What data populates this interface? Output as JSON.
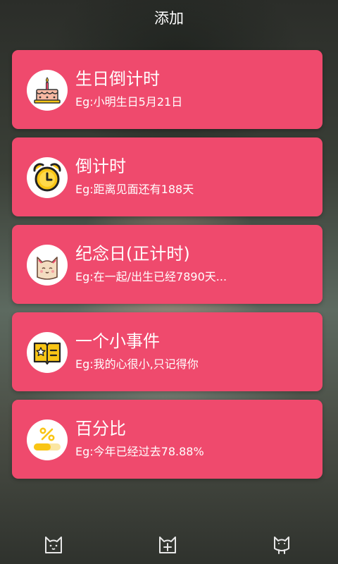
{
  "header": {
    "title": "添加"
  },
  "cards": [
    {
      "title": "生日倒计时",
      "subtitle": "Eg:小明生日5月21日",
      "icon": "cake-icon"
    },
    {
      "title": "倒计时",
      "subtitle": "Eg:距离见面还有188天",
      "icon": "alarm-clock-icon"
    },
    {
      "title": "纪念日(正计时)",
      "subtitle": "Eg:在一起/出生已经7890天...",
      "icon": "cat-face-icon"
    },
    {
      "title": "一个小事件",
      "subtitle": "Eg:我的心很小,只记得你",
      "icon": "star-note-icon"
    },
    {
      "title": "百分比",
      "subtitle": "Eg:今年已经过去78.88%",
      "icon": "percent-progress-icon"
    }
  ],
  "tabs": [
    {
      "icon": "cat-home-icon"
    },
    {
      "icon": "add-tab-icon"
    },
    {
      "icon": "cat-profile-icon"
    }
  ],
  "colors": {
    "card": "#ef4a6d",
    "text": "#ffffff",
    "accent_yellow": "#f9c515"
  }
}
